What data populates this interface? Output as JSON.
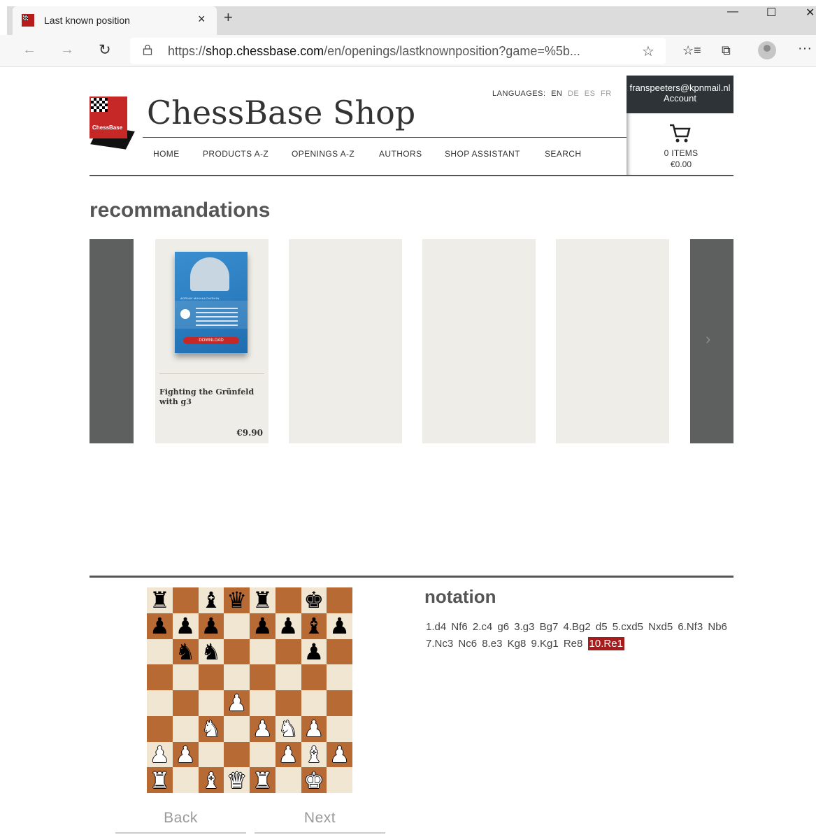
{
  "browser": {
    "tab_title": "Last known position",
    "tab_close": "×",
    "new_tab": "+",
    "window": {
      "minimize": "—",
      "maximize": "☐",
      "close": "✕"
    },
    "back_icon": "←",
    "forward_icon": "→",
    "reload_icon": "↻",
    "lock_icon": "🔒",
    "url_prefix": "https://",
    "url_host": "shop.chessbase.com",
    "url_path": "/en/openings/lastknownposition?game=%5b...",
    "star_icon": "☆",
    "favorites_icon": "☆≡",
    "collections_icon": "⧉",
    "menu_icon": "···"
  },
  "header": {
    "logo_text": "ChessBase",
    "site_title": "ChessBase Shop",
    "languages_label": "LANGUAGES:",
    "languages": [
      "EN",
      "DE",
      "ES",
      "FR"
    ],
    "active_language": "EN",
    "nav": [
      "HOME",
      "PRODUCTS A-Z",
      "OPENINGS A-Z",
      "AUTHORS",
      "SHOP ASSISTANT",
      "SEARCH"
    ],
    "account_email": "franspeeters@kpnmail.nl",
    "account_label": "Account",
    "cart_icon": "🛒",
    "cart_items": "0 ITEMS",
    "cart_total": "€0.00"
  },
  "recommendations": {
    "heading": "recommandations",
    "next_arrow": "›",
    "products": [
      {
        "title": "Fighting the Grünfeld with g3",
        "price": "€9.90",
        "cover_author": "ADRIAN MIKHALCHISHIN",
        "cover_button": "DOWNLOAD"
      }
    ]
  },
  "board": {
    "rows": [
      [
        {
          "p": "♜",
          "c": "b"
        },
        {
          "p": "",
          "c": ""
        },
        {
          "p": "♝",
          "c": "b"
        },
        {
          "p": "♛",
          "c": "b"
        },
        {
          "p": "♜",
          "c": "b"
        },
        {
          "p": "",
          "c": ""
        },
        {
          "p": "♚",
          "c": "b"
        },
        {
          "p": "",
          "c": ""
        }
      ],
      [
        {
          "p": "♟",
          "c": "b"
        },
        {
          "p": "♟",
          "c": "b"
        },
        {
          "p": "♟",
          "c": "b"
        },
        {
          "p": "",
          "c": ""
        },
        {
          "p": "♟",
          "c": "b"
        },
        {
          "p": "♟",
          "c": "b"
        },
        {
          "p": "♝",
          "c": "b"
        },
        {
          "p": "♟",
          "c": "b"
        }
      ],
      [
        {
          "p": "",
          "c": ""
        },
        {
          "p": "♞",
          "c": "b"
        },
        {
          "p": "♞",
          "c": "b"
        },
        {
          "p": "",
          "c": ""
        },
        {
          "p": "",
          "c": ""
        },
        {
          "p": "",
          "c": ""
        },
        {
          "p": "♟",
          "c": "b"
        },
        {
          "p": "",
          "c": ""
        }
      ],
      [
        {
          "p": "",
          "c": ""
        },
        {
          "p": "",
          "c": ""
        },
        {
          "p": "",
          "c": ""
        },
        {
          "p": "",
          "c": ""
        },
        {
          "p": "",
          "c": ""
        },
        {
          "p": "",
          "c": ""
        },
        {
          "p": "",
          "c": ""
        },
        {
          "p": "",
          "c": ""
        }
      ],
      [
        {
          "p": "",
          "c": ""
        },
        {
          "p": "",
          "c": ""
        },
        {
          "p": "",
          "c": ""
        },
        {
          "p": "♟",
          "c": "w"
        },
        {
          "p": "",
          "c": ""
        },
        {
          "p": "",
          "c": ""
        },
        {
          "p": "",
          "c": ""
        },
        {
          "p": "",
          "c": ""
        }
      ],
      [
        {
          "p": "",
          "c": ""
        },
        {
          "p": "",
          "c": ""
        },
        {
          "p": "♞",
          "c": "w"
        },
        {
          "p": "",
          "c": ""
        },
        {
          "p": "♟",
          "c": "w"
        },
        {
          "p": "♞",
          "c": "w"
        },
        {
          "p": "♟",
          "c": "w"
        },
        {
          "p": "",
          "c": ""
        }
      ],
      [
        {
          "p": "♟",
          "c": "w"
        },
        {
          "p": "♟",
          "c": "w"
        },
        {
          "p": "",
          "c": ""
        },
        {
          "p": "",
          "c": ""
        },
        {
          "p": "",
          "c": ""
        },
        {
          "p": "♟",
          "c": "w"
        },
        {
          "p": "♝",
          "c": "w"
        },
        {
          "p": "♟",
          "c": "w"
        }
      ],
      [
        {
          "p": "♜",
          "c": "w"
        },
        {
          "p": "",
          "c": ""
        },
        {
          "p": "♝",
          "c": "w"
        },
        {
          "p": "♛",
          "c": "w"
        },
        {
          "p": "♜",
          "c": "w"
        },
        {
          "p": "",
          "c": ""
        },
        {
          "p": "♚",
          "c": "w"
        },
        {
          "p": "",
          "c": ""
        }
      ]
    ]
  },
  "notation": {
    "heading": "notation",
    "moves": [
      "1.d4",
      "Nf6",
      "2.c4",
      "g6",
      "3.g3",
      "Bg7",
      "4.Bg2",
      "d5",
      "5.cxd5",
      "Nxd5",
      "6.Nf3",
      "Nb6",
      "7.Nc3",
      "Nc6",
      "8.e3",
      "Kg8",
      "9.Kg1",
      "Re8",
      "10.Re1"
    ],
    "current_index": 18
  },
  "controls": {
    "back": "Back",
    "next": "Next"
  },
  "colors": {
    "accent": "#a61c1c",
    "dark_panel": "#2d3336",
    "card_bg": "#efede7",
    "board_light": "#f1e6d2",
    "board_dark": "#b86a35"
  }
}
